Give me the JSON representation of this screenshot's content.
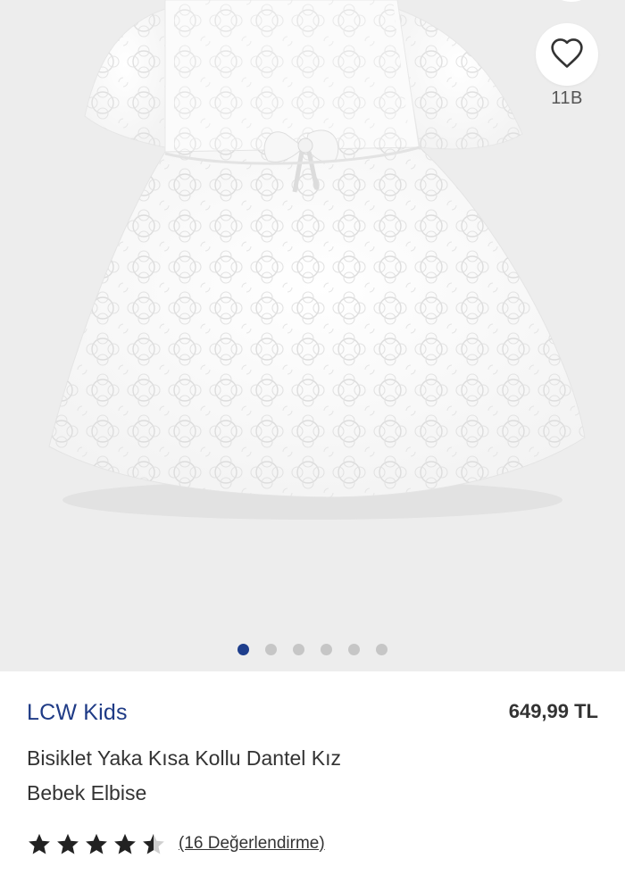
{
  "gallery": {
    "favorite_count": "11B",
    "image_count": 6,
    "active_index": 0,
    "active_dot_color": "#1e3e8c",
    "inactive_dot_color": "#c6c6c6"
  },
  "product": {
    "brand": "LCW Kids",
    "price": "649,99 TL",
    "title_line1": "Bisiklet Yaka Kısa Kollu Dantel Kız",
    "title_line2": "Bebek Elbise",
    "rating": 4.5,
    "reviews_label": "(16 Değerlendirme)",
    "brand_color": "#1f3b86"
  },
  "icons": {
    "favorite": "heart-outline-icon",
    "star": "star-icon"
  }
}
